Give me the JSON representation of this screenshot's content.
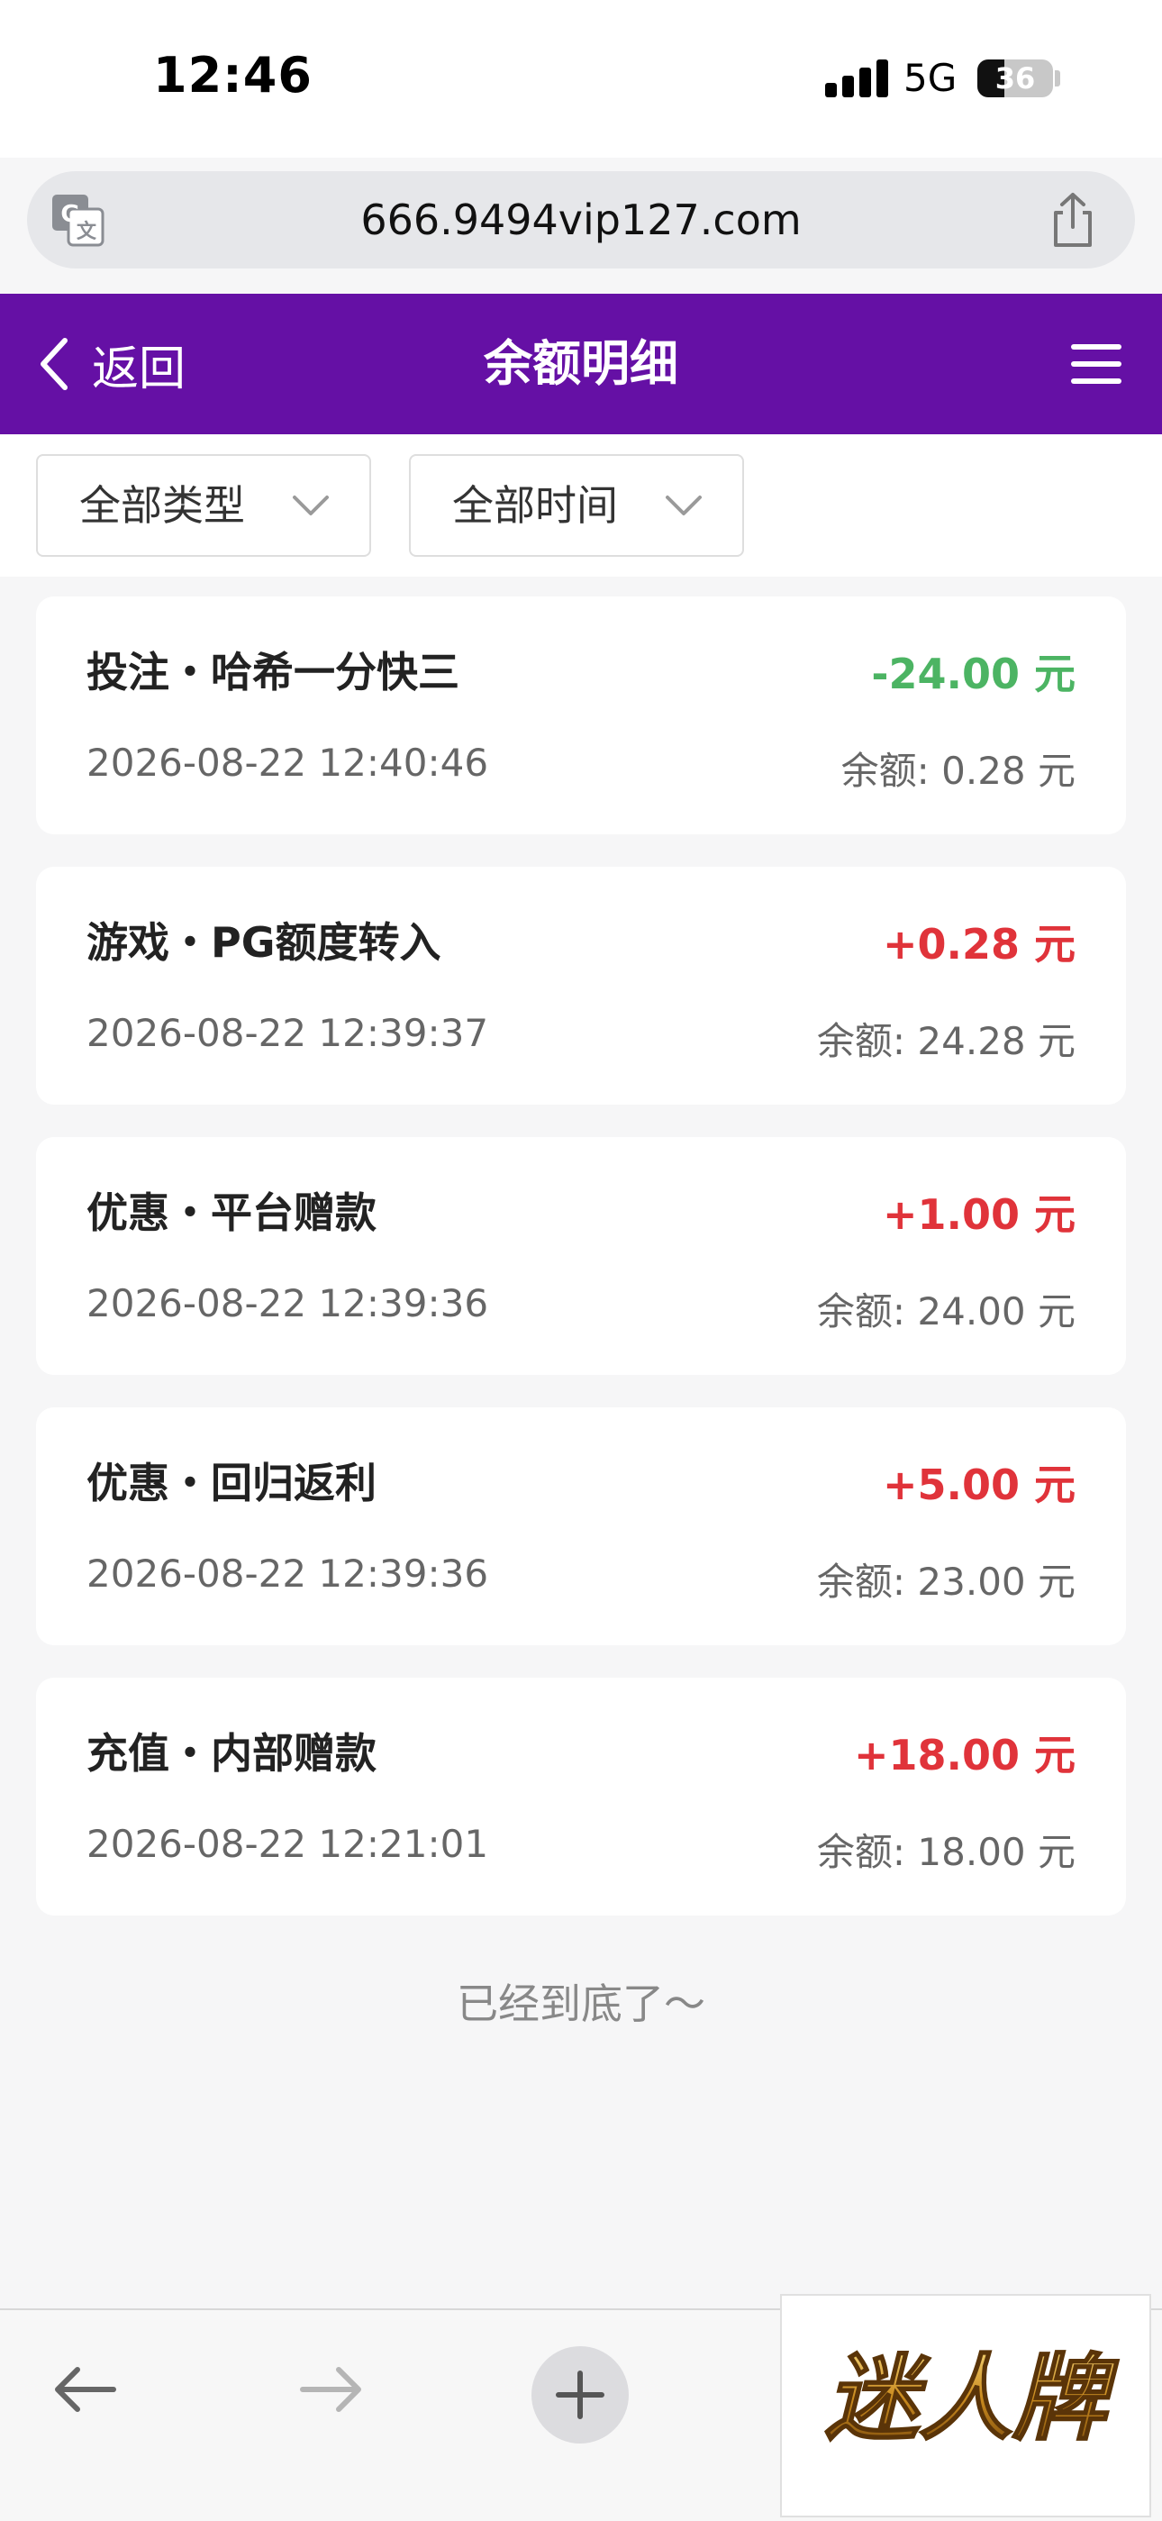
{
  "status_bar": {
    "time": "12:46",
    "network": "5G",
    "battery_level": "36",
    "battery_percent": 36
  },
  "browser": {
    "url": "666.9494vip127.com",
    "icons": {
      "translate": "translate-icon",
      "share": "share-icon"
    }
  },
  "header": {
    "back_label": "返回",
    "title": "余额明细",
    "background_color": "#6510a5",
    "icons": {
      "back": "chevron-left-icon",
      "menu": "hamburger-menu-icon"
    }
  },
  "filters": [
    {
      "label": "全部类型",
      "icon": "chevron-down-icon"
    },
    {
      "label": "全部时间",
      "icon": "chevron-down-icon"
    }
  ],
  "transactions": [
    {
      "title": "投注・哈希一分快三",
      "amount": "-24.00 元",
      "direction": "negative",
      "time": "2026-08-22 12:40:46",
      "balance": "余额: 0.28 元"
    },
    {
      "title": "游戏・PG额度转入",
      "amount": "+0.28 元",
      "direction": "positive",
      "time": "2026-08-22 12:39:37",
      "balance": "余额: 24.28 元"
    },
    {
      "title": "优惠・平台赠款",
      "amount": "+1.00 元",
      "direction": "positive",
      "time": "2026-08-22 12:39:36",
      "balance": "余额: 24.00 元"
    },
    {
      "title": "优惠・回归返利",
      "amount": "+5.00 元",
      "direction": "positive",
      "time": "2026-08-22 12:39:36",
      "balance": "余额: 23.00 元"
    },
    {
      "title": "充值・内部赠款",
      "amount": "+18.00 元",
      "direction": "positive",
      "time": "2026-08-22 12:21:01",
      "balance": "余额: 18.00 元"
    }
  ],
  "colors": {
    "negative_amount": "#4cb463",
    "positive_amount": "#e0333a"
  },
  "end_text": "已经到底了～",
  "bottom_toolbar": {
    "icons": {
      "back": "arrow-left-icon",
      "forward": "arrow-right-icon",
      "new_tab": "plus-icon"
    },
    "watermark_text": "迷人牌"
  }
}
